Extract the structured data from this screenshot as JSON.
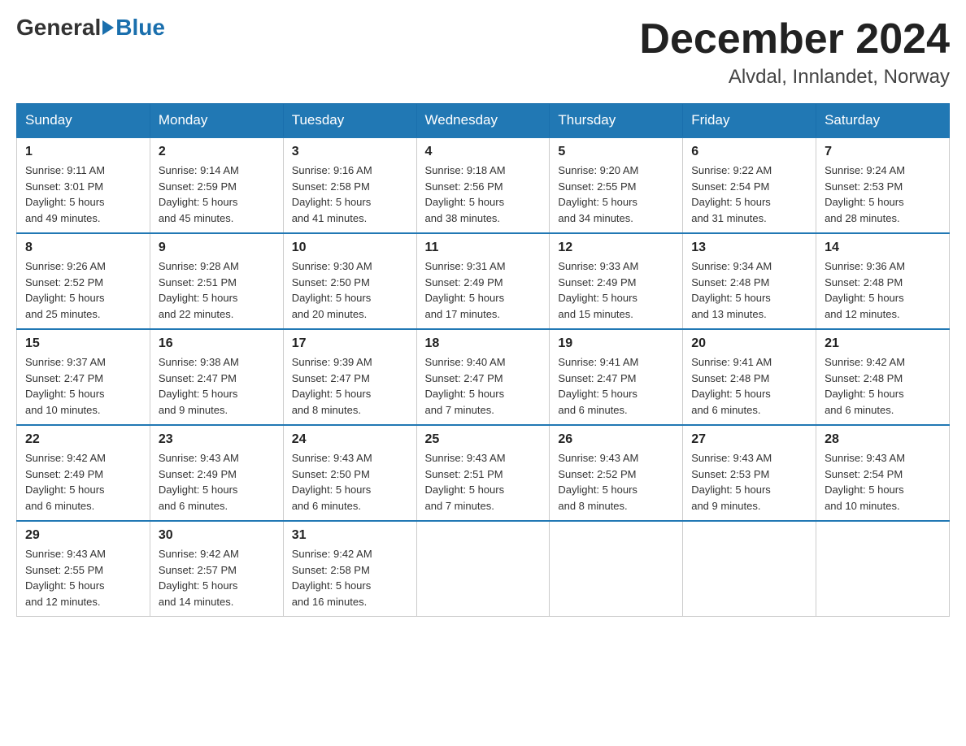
{
  "logo": {
    "general": "General",
    "blue": "Blue"
  },
  "title": {
    "month": "December 2024",
    "location": "Alvdal, Innlandet, Norway"
  },
  "weekdays": [
    "Sunday",
    "Monday",
    "Tuesday",
    "Wednesday",
    "Thursday",
    "Friday",
    "Saturday"
  ],
  "weeks": [
    [
      {
        "day": "1",
        "sunrise": "9:11 AM",
        "sunset": "3:01 PM",
        "daylight": "5 hours and 49 minutes."
      },
      {
        "day": "2",
        "sunrise": "9:14 AM",
        "sunset": "2:59 PM",
        "daylight": "5 hours and 45 minutes."
      },
      {
        "day": "3",
        "sunrise": "9:16 AM",
        "sunset": "2:58 PM",
        "daylight": "5 hours and 41 minutes."
      },
      {
        "day": "4",
        "sunrise": "9:18 AM",
        "sunset": "2:56 PM",
        "daylight": "5 hours and 38 minutes."
      },
      {
        "day": "5",
        "sunrise": "9:20 AM",
        "sunset": "2:55 PM",
        "daylight": "5 hours and 34 minutes."
      },
      {
        "day": "6",
        "sunrise": "9:22 AM",
        "sunset": "2:54 PM",
        "daylight": "5 hours and 31 minutes."
      },
      {
        "day": "7",
        "sunrise": "9:24 AM",
        "sunset": "2:53 PM",
        "daylight": "5 hours and 28 minutes."
      }
    ],
    [
      {
        "day": "8",
        "sunrise": "9:26 AM",
        "sunset": "2:52 PM",
        "daylight": "5 hours and 25 minutes."
      },
      {
        "day": "9",
        "sunrise": "9:28 AM",
        "sunset": "2:51 PM",
        "daylight": "5 hours and 22 minutes."
      },
      {
        "day": "10",
        "sunrise": "9:30 AM",
        "sunset": "2:50 PM",
        "daylight": "5 hours and 20 minutes."
      },
      {
        "day": "11",
        "sunrise": "9:31 AM",
        "sunset": "2:49 PM",
        "daylight": "5 hours and 17 minutes."
      },
      {
        "day": "12",
        "sunrise": "9:33 AM",
        "sunset": "2:49 PM",
        "daylight": "5 hours and 15 minutes."
      },
      {
        "day": "13",
        "sunrise": "9:34 AM",
        "sunset": "2:48 PM",
        "daylight": "5 hours and 13 minutes."
      },
      {
        "day": "14",
        "sunrise": "9:36 AM",
        "sunset": "2:48 PM",
        "daylight": "5 hours and 12 minutes."
      }
    ],
    [
      {
        "day": "15",
        "sunrise": "9:37 AM",
        "sunset": "2:47 PM",
        "daylight": "5 hours and 10 minutes."
      },
      {
        "day": "16",
        "sunrise": "9:38 AM",
        "sunset": "2:47 PM",
        "daylight": "5 hours and 9 minutes."
      },
      {
        "day": "17",
        "sunrise": "9:39 AM",
        "sunset": "2:47 PM",
        "daylight": "5 hours and 8 minutes."
      },
      {
        "day": "18",
        "sunrise": "9:40 AM",
        "sunset": "2:47 PM",
        "daylight": "5 hours and 7 minutes."
      },
      {
        "day": "19",
        "sunrise": "9:41 AM",
        "sunset": "2:47 PM",
        "daylight": "5 hours and 6 minutes."
      },
      {
        "day": "20",
        "sunrise": "9:41 AM",
        "sunset": "2:48 PM",
        "daylight": "5 hours and 6 minutes."
      },
      {
        "day": "21",
        "sunrise": "9:42 AM",
        "sunset": "2:48 PM",
        "daylight": "5 hours and 6 minutes."
      }
    ],
    [
      {
        "day": "22",
        "sunrise": "9:42 AM",
        "sunset": "2:49 PM",
        "daylight": "5 hours and 6 minutes."
      },
      {
        "day": "23",
        "sunrise": "9:43 AM",
        "sunset": "2:49 PM",
        "daylight": "5 hours and 6 minutes."
      },
      {
        "day": "24",
        "sunrise": "9:43 AM",
        "sunset": "2:50 PM",
        "daylight": "5 hours and 6 minutes."
      },
      {
        "day": "25",
        "sunrise": "9:43 AM",
        "sunset": "2:51 PM",
        "daylight": "5 hours and 7 minutes."
      },
      {
        "day": "26",
        "sunrise": "9:43 AM",
        "sunset": "2:52 PM",
        "daylight": "5 hours and 8 minutes."
      },
      {
        "day": "27",
        "sunrise": "9:43 AM",
        "sunset": "2:53 PM",
        "daylight": "5 hours and 9 minutes."
      },
      {
        "day": "28",
        "sunrise": "9:43 AM",
        "sunset": "2:54 PM",
        "daylight": "5 hours and 10 minutes."
      }
    ],
    [
      {
        "day": "29",
        "sunrise": "9:43 AM",
        "sunset": "2:55 PM",
        "daylight": "5 hours and 12 minutes."
      },
      {
        "day": "30",
        "sunrise": "9:42 AM",
        "sunset": "2:57 PM",
        "daylight": "5 hours and 14 minutes."
      },
      {
        "day": "31",
        "sunrise": "9:42 AM",
        "sunset": "2:58 PM",
        "daylight": "5 hours and 16 minutes."
      },
      null,
      null,
      null,
      null
    ]
  ],
  "labels": {
    "sunrise": "Sunrise:",
    "sunset": "Sunset:",
    "daylight": "Daylight:"
  }
}
